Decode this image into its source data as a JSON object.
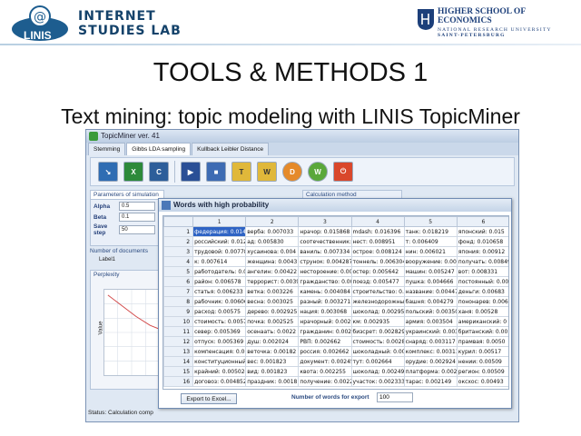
{
  "header": {
    "left_logo": {
      "badge_text": "LINIS",
      "line1": "INTERNET",
      "line2": "STUDIES LAB"
    },
    "right_logo": {
      "line1": "HIGHER SCHOOL OF ECONOMICS",
      "line2": "NATIONAL RESEARCH UNIVERSITY",
      "line3": "SAINT-PETERSBURG"
    }
  },
  "slide": {
    "title": "TOOLS & METHODS 1",
    "subtitle": "Text mining: topic modeling with LINIS TopicMiner"
  },
  "app": {
    "window_title": "TopicMiner ver. 41",
    "tabs": [
      "Stemming",
      "Gibbs LDA sampling",
      "Kullback Leibler Distance"
    ],
    "active_tab": 1,
    "params_header": "Parameters of simulation",
    "params": [
      {
        "label": "Alpha",
        "value": "0.5"
      },
      {
        "label": "Beta",
        "value": "0.1"
      },
      {
        "label": "Save step",
        "value": "50"
      }
    ],
    "calc_header": "Calculation method",
    "num_docs_label": "Number of documents",
    "label1": "Label1",
    "perplexity_header": "Perplexity",
    "perplexity_axis": "Value",
    "status": "Status: Calculation comp"
  },
  "dialog": {
    "title": "Words with high probability",
    "columns": [
      "",
      "1",
      "2",
      "3",
      "4",
      "5",
      "6"
    ],
    "rows": [
      [
        "1",
        "федерация: 0.014",
        "верба: 0.007033",
        "нрачор: 0.015868",
        "mdash: 0.016396",
        "танк: 0.018219",
        "японский: 0.015"
      ],
      [
        "2",
        "российский: 0.012",
        "ад: 0.005830",
        "соотечественник: 0.0",
        "нест: 0.008951",
        "т: 0.006409",
        "фонд: 0.010658"
      ],
      [
        "3",
        "трудовой: 0.00778",
        "хусаинова: 0.004",
        "ваниль: 0.007334",
        "острое: 0.008124",
        "нин: 0.006021",
        "япония: 0.00912"
      ],
      [
        "4",
        "к: 0.007614",
        "женщина: 0.0043",
        "струнок: 0.004287",
        "тоннель: 0.006304",
        "вооружение: 0.0054",
        "получать: 0.00849"
      ],
      [
        "5",
        "работодатель: 0.0",
        "ангелин: 0.00422",
        "нестороение: 0.00",
        "остер: 0.005642",
        "машин: 0.005247",
        "вот: 0.008331"
      ],
      [
        "6",
        "район: 0.006578",
        "террорист: 0.0039",
        "гражданство: 0.00405",
        "поезд: 0.005477",
        "пушка: 0.004666",
        "постоянный: 0.006"
      ],
      [
        "7",
        "статья: 0.006233",
        "ветка: 0.003226",
        "камень: 0.004084",
        "строительство: 0.0",
        "название: 0.00447",
        "деньги: 0.00683"
      ],
      [
        "8",
        "рабочник: 0.00606",
        "весна: 0.003025",
        "разный: 0.003271",
        "железнодорожный:",
        "башня: 0.004279",
        "пононарев: 0.006"
      ],
      [
        "9",
        "расход: 0.00575",
        "дерево: 0.002925",
        "нация: 0.003068",
        "шоколад: 0.002955",
        "польский: 0.003504",
        "ханя: 0.00528"
      ],
      [
        "10",
        "стоимость: 0.0057",
        "почка: 0.002525",
        "нрачорный: 0.00286",
        "км: 0.002935",
        "армия: 0.003504",
        "американский: 0"
      ],
      [
        "11",
        "север: 0.005369",
        "осенаать: 0.0022",
        "гражданин: 0.00286",
        "бизсрет: 0.002829",
        "украинский: 0.00331",
        "британский: 0.00"
      ],
      [
        "12",
        "отпуск: 0.005369",
        "душ: 0.002024",
        "РВП: 0.002662",
        "стоимость: 0.0028",
        "снаряд: 0.003117",
        "прамвая: 0.0050"
      ],
      [
        "13",
        "компенсация: 0.00",
        "веточка: 0.00182",
        "россия: 0.002662",
        "шоколадный: 0.00",
        "комплекс: 0.003117",
        "курил: 0.00517"
      ],
      [
        "14",
        "конституционный",
        "вес: 0.001823",
        "документ: 0.002459",
        "тут: 0.002664",
        "орудие: 0.002924",
        "нении: 0.00509"
      ],
      [
        "15",
        "крайний: 0.005024",
        "вид: 0.001823",
        "квота: 0.002255",
        "шоколад: 0.002498",
        "платформа: 0.00224",
        "регион: 0.00509"
      ],
      [
        "16",
        "договоз: 0.004852",
        "праздник: 0.0018",
        "получение: 0.002255",
        "участок: 0.002333",
        "тарас: 0.002149",
        "оксхос: 0.00493"
      ]
    ],
    "export_button": "Export to Excel...",
    "num_words_label": "Number of words for export",
    "num_words_value": "100"
  }
}
